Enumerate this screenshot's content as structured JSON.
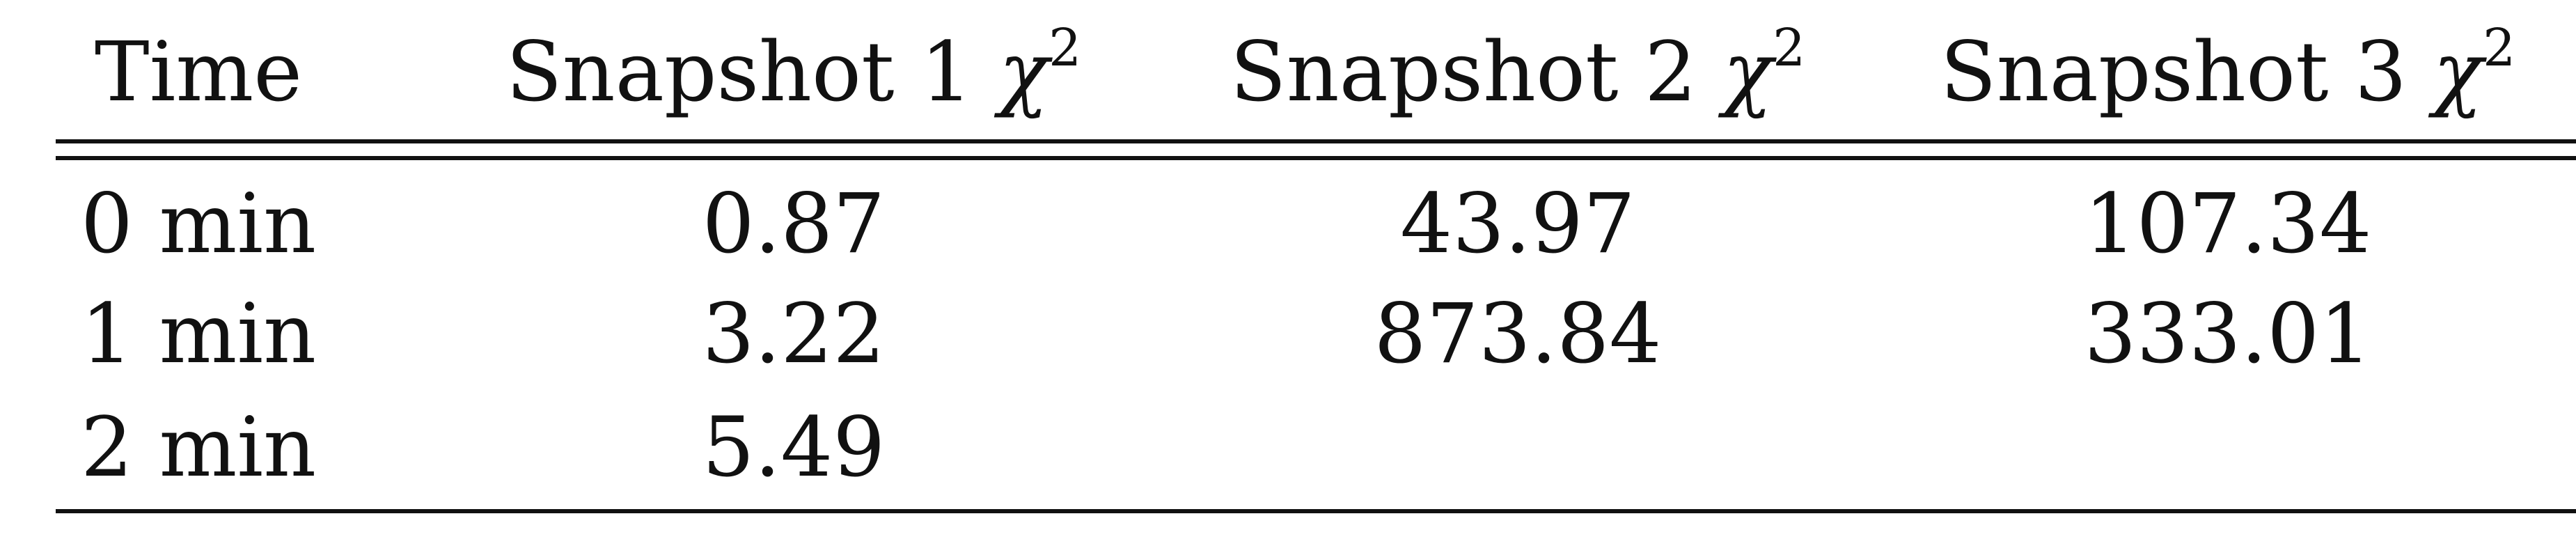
{
  "table": {
    "headers": [
      {
        "text": "Time"
      },
      {
        "prefix": "Snapshot 1 ",
        "symbol": "χ",
        "sup": "2"
      },
      {
        "prefix": "Snapshot 2 ",
        "symbol": "χ",
        "sup": "2"
      },
      {
        "prefix": "Snapshot 3 ",
        "symbol": "χ",
        "sup": "2"
      }
    ],
    "rows": [
      [
        "0 min",
        "0.87",
        "43.97",
        "107.34"
      ],
      [
        "1 min",
        "3.22",
        "873.84",
        "333.01"
      ],
      [
        "2 min",
        "5.49",
        "",
        ""
      ]
    ]
  }
}
